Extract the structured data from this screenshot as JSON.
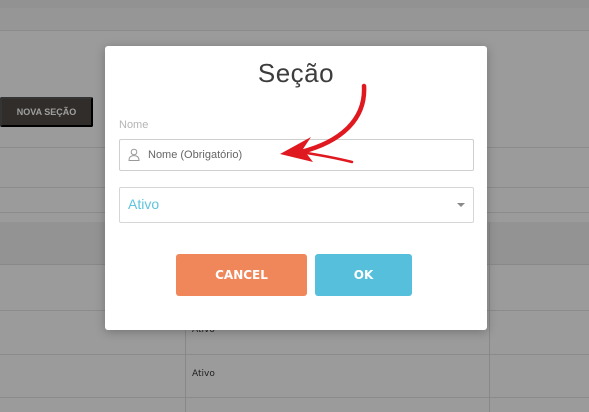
{
  "background": {
    "new_section_button": "NOVA SEÇÃO",
    "table_rows": [
      "Ativo",
      "Ativo"
    ]
  },
  "modal": {
    "title": "Seção",
    "name_label": "Nome",
    "name_placeholder": "Nome (Obrigatório)",
    "name_value": "",
    "status_select": "Ativo",
    "cancel_label": "CANCEL",
    "ok_label": "OK"
  },
  "colors": {
    "cancel": "#f0875a",
    "ok": "#56bfdc",
    "select_text": "#5ec4dd",
    "annotation_arrow": "#e0181f"
  },
  "icons": {
    "name_field": "user-icon",
    "select": "chevron-down-icon",
    "annotation": "red-arrow-icon"
  }
}
